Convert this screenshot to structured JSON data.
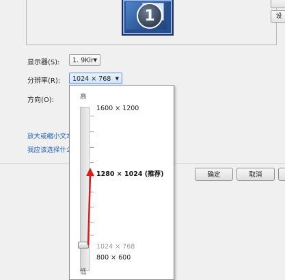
{
  "monitor": {
    "number": "1"
  },
  "side_buttons": [
    "",
    "",
    "设"
  ],
  "display": {
    "label": "显示器(S):",
    "value": "1. 9Klr"
  },
  "resolution": {
    "label": "分辨率(R):",
    "value": "1024 × 768"
  },
  "orientation": {
    "label": "方向(O):"
  },
  "links": [
    "放大或缩小文本",
    "我应该选择什么"
  ],
  "buttons": {
    "ok": "确定",
    "cancel": "取消",
    "apply": ""
  },
  "dropdown": {
    "high_label": "高",
    "low_label": "低",
    "options": [
      {
        "text": "1600 × 1200",
        "state": "normal"
      },
      {
        "text": "1280 × 1024 (推荐)",
        "state": "recommended"
      },
      {
        "text": "1024 × 768",
        "state": "current"
      },
      {
        "text": "800 × 600",
        "state": "normal"
      }
    ],
    "slider_level_option": "1024 × 768"
  },
  "colors": {
    "link": "#1a5fb4",
    "arrow": "#e01b1b",
    "accent": "#5b8fd6"
  }
}
